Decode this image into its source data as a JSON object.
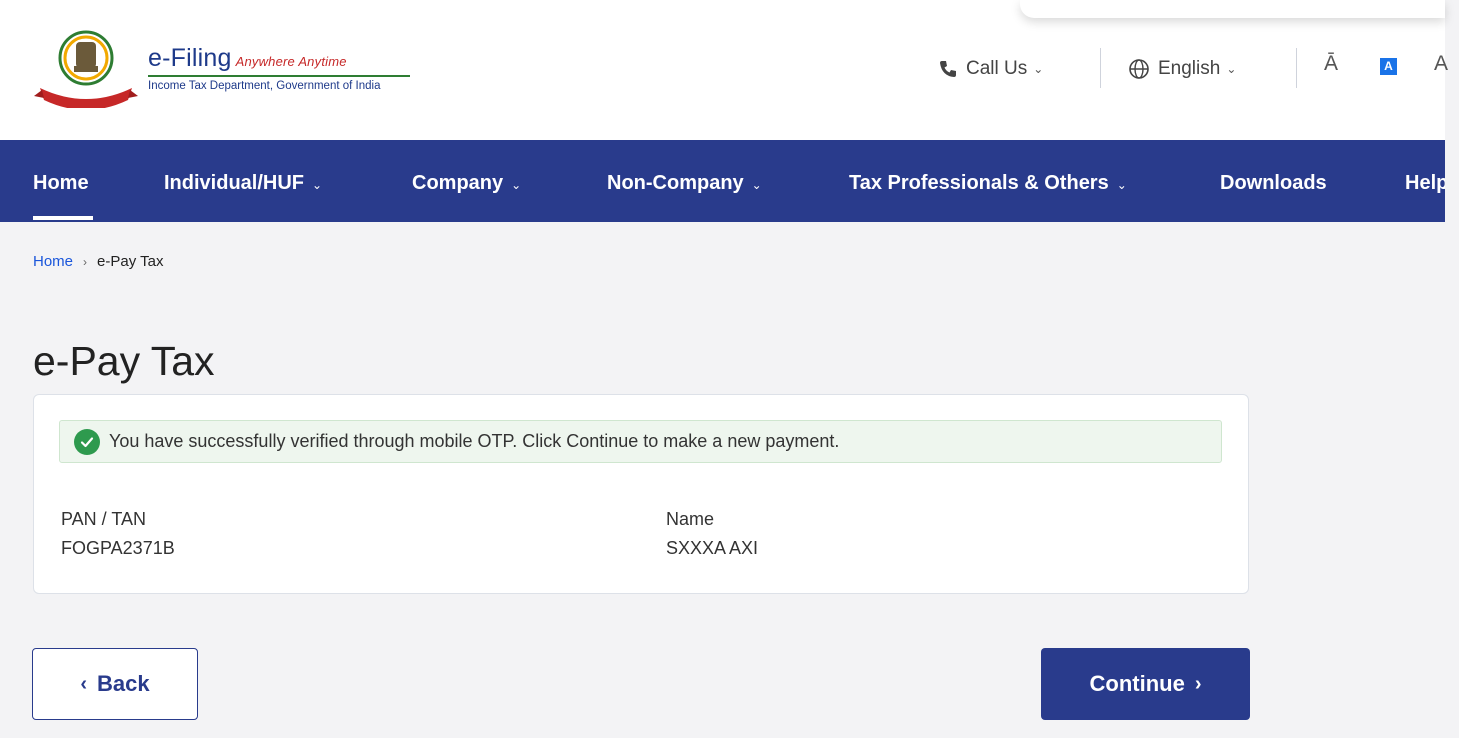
{
  "brand": {
    "title": "e-Filing",
    "tagline": "Anywhere Anytime",
    "subtitle": "Income Tax Department, Government of India",
    "emblem_ribbon": "INCOME TAX DEPARTMENT"
  },
  "utility": {
    "call_us": "Call Us",
    "language": "English",
    "font_decrease": "Ā",
    "font_normal": "A",
    "font_increase": "A"
  },
  "nav": {
    "items": [
      {
        "label": "Home"
      },
      {
        "label": "Individual/HUF"
      },
      {
        "label": "Company"
      },
      {
        "label": "Non-Company"
      },
      {
        "label": "Tax Professionals & Others"
      },
      {
        "label": "Downloads"
      },
      {
        "label": "Help"
      }
    ]
  },
  "breadcrumb": {
    "home": "Home",
    "current": "e-Pay Tax"
  },
  "page": {
    "title": "e-Pay Tax"
  },
  "alert": {
    "message": "You have successfully verified through mobile OTP. Click Continue to make a new payment."
  },
  "details": {
    "pan_label": "PAN / TAN",
    "pan_value": "FOGPA2371B",
    "name_label": "Name",
    "name_value": "SXXXA AXI"
  },
  "actions": {
    "back": "Back",
    "continue": "Continue"
  },
  "colors": {
    "primary": "#293b8c",
    "success": "#2e9a4e",
    "link": "#1a56db"
  }
}
